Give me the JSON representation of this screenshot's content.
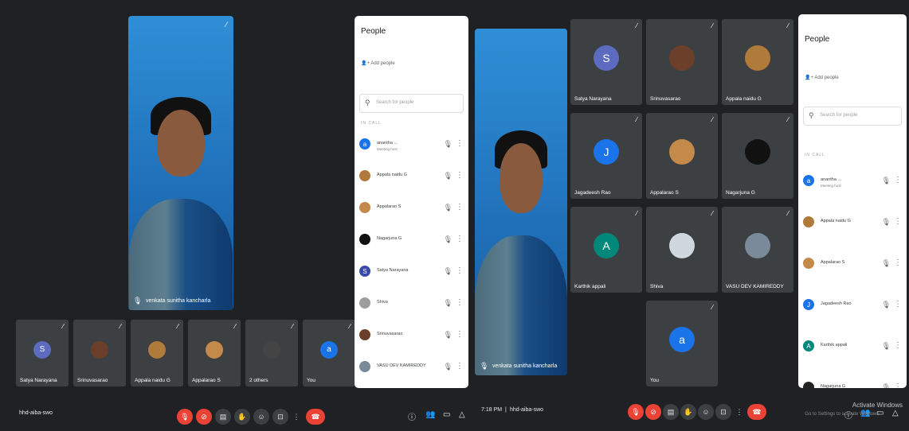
{
  "left": {
    "speaker": {
      "name": "venkata sunitha kancharla"
    },
    "tiles": [
      {
        "name": "Satya Narayana",
        "initial": "S",
        "color": "#5c6bc0",
        "photo": false
      },
      {
        "name": "Srinuvasarao",
        "initial": "",
        "color": "#6b3f2a",
        "photo": true
      },
      {
        "name": "Appala naidu G",
        "initial": "",
        "color": "#b07a3a",
        "photo": true
      },
      {
        "name": "Appalarao S",
        "initial": "",
        "color": "#c48a4a",
        "photo": true
      },
      {
        "name": "2 others",
        "initial": "",
        "color": "#444",
        "photo": true
      },
      {
        "name": "You",
        "initial": "a",
        "color": "#1a73e8",
        "photo": false
      }
    ],
    "panel": {
      "title": "People",
      "add_people": "Add people",
      "search_placeholder": "Search for people",
      "section": "IN CALL",
      "people": [
        {
          "name": "anantha ...",
          "sub": "Meeting host",
          "initial": "a",
          "color": "#1a73e8"
        },
        {
          "name": "Appala naidu G",
          "sub": "",
          "initial": "",
          "color": "#b07a3a"
        },
        {
          "name": "Appalarao S",
          "sub": "",
          "initial": "",
          "color": "#c48a4a"
        },
        {
          "name": "Nagarjuna G",
          "sub": "",
          "initial": "",
          "color": "#111"
        },
        {
          "name": "Satya Narayana",
          "sub": "",
          "initial": "S",
          "color": "#3949ab"
        },
        {
          "name": "Shiva",
          "sub": "",
          "initial": "",
          "color": "#9e9e9e"
        },
        {
          "name": "Srinuvasarao",
          "sub": "",
          "initial": "",
          "color": "#6b3f2a"
        },
        {
          "name": "VASU DEV KAMIREDDY",
          "sub": "",
          "initial": "",
          "color": "#7a8a9a"
        }
      ]
    },
    "bar": {
      "meeting": "hhd-aiba-swo"
    }
  },
  "right": {
    "speaker": {
      "name": "venkata sunitha kancharla"
    },
    "tiles": [
      {
        "name": "Satya Narayana",
        "initial": "S",
        "color": "#5c6bc0",
        "photo": false
      },
      {
        "name": "Srinuvasarao",
        "initial": "",
        "color": "#6b3f2a",
        "photo": true
      },
      {
        "name": "Appala naidu G",
        "initial": "",
        "color": "#b07a3a",
        "photo": true
      },
      {
        "name": "Jagadeesh Rao",
        "initial": "J",
        "color": "#1a73e8",
        "photo": false
      },
      {
        "name": "Appalarao S",
        "initial": "",
        "color": "#c48a4a",
        "photo": true
      },
      {
        "name": "Nagarjuna G",
        "initial": "",
        "color": "#111",
        "photo": true
      },
      {
        "name": "Karthik appali",
        "initial": "A",
        "color": "#00897b",
        "photo": false
      },
      {
        "name": "Shiva",
        "initial": "",
        "color": "#cfd8dc",
        "photo": true
      },
      {
        "name": "VASU DEV KAMIREDDY",
        "initial": "",
        "color": "#7a8a9a",
        "photo": true
      },
      {
        "name": "You",
        "initial": "a",
        "color": "#1a73e8",
        "photo": false
      }
    ],
    "panel": {
      "title": "People",
      "add_people": "Add people",
      "search_placeholder": "Search for people",
      "section": "IN CALL",
      "people": [
        {
          "name": "anantha ...",
          "sub": "Meeting host",
          "initial": "a",
          "color": "#1a73e8"
        },
        {
          "name": "Appala naidu G",
          "sub": "",
          "initial": "",
          "color": "#b07a3a"
        },
        {
          "name": "Appalarao S",
          "sub": "",
          "initial": "",
          "color": "#c48a4a"
        },
        {
          "name": "Jagadeesh Rao",
          "sub": "",
          "initial": "J",
          "color": "#1a73e8"
        },
        {
          "name": "Karthik appali",
          "sub": "",
          "initial": "A",
          "color": "#00897b"
        },
        {
          "name": "Nagarjuna G",
          "sub": "",
          "initial": "",
          "color": "#222"
        }
      ]
    },
    "bar": {
      "time": "7:18 PM",
      "meeting": "hhd-aiba-swo"
    },
    "watermark": {
      "line1": "Activate Windows",
      "line2": "Go to Settings to activate Windows."
    }
  }
}
